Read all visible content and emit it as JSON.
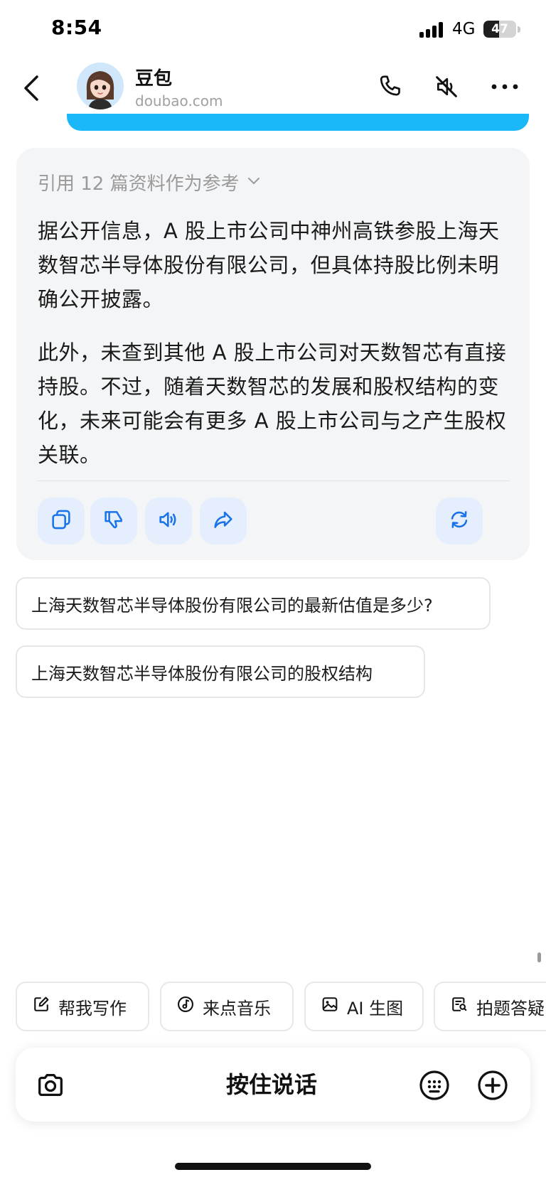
{
  "status_bar": {
    "time": "8:54",
    "network": "4G",
    "battery": "47",
    "battery_level_pct": 47
  },
  "header": {
    "name": "豆包",
    "domain": "doubao.com",
    "icons": [
      "back-icon",
      "phone-icon",
      "speaker-muted-icon",
      "more-icon"
    ]
  },
  "answer": {
    "reference_label": "引用 12 篇资料作为参考",
    "paragraphs": [
      "据公开信息，A 股上市公司中神州高铁参股上海天数智芯半导体股份有限公司，但具体持股比例未明确公开披露。",
      "此外，未查到其他 A 股上市公司对天数智芯有直接持股。不过，随着天数智芯的发展和股权结构的变化，未来可能会有更多 A 股上市公司与之产生股权关联。"
    ],
    "actions": [
      "copy-icon",
      "dislike-icon",
      "read-aloud-icon",
      "share-icon",
      "regenerate-icon"
    ]
  },
  "suggestions": [
    "上海天数智芯半导体股份有限公司的最新估值是多少?",
    "上海天数智芯半导体股份有限公司的股权结构"
  ],
  "chips": [
    {
      "label": "帮我写作",
      "icon": "edit-icon"
    },
    {
      "label": "来点音乐",
      "icon": "music-icon"
    },
    {
      "label": "AI 生图",
      "icon": "image-icon"
    },
    {
      "label": "拍题答疑",
      "icon": "search-doc-icon"
    }
  ],
  "input_bar": {
    "hold_to_talk": "按住说话",
    "icons": [
      "camera-icon",
      "keypad-icon",
      "plus-icon"
    ]
  },
  "colors": {
    "accent_blue": "#1a73e8",
    "bubble_blue": "#1ab8f8",
    "card_bg": "#f4f5f7",
    "action_bg": "#e4eefc"
  }
}
